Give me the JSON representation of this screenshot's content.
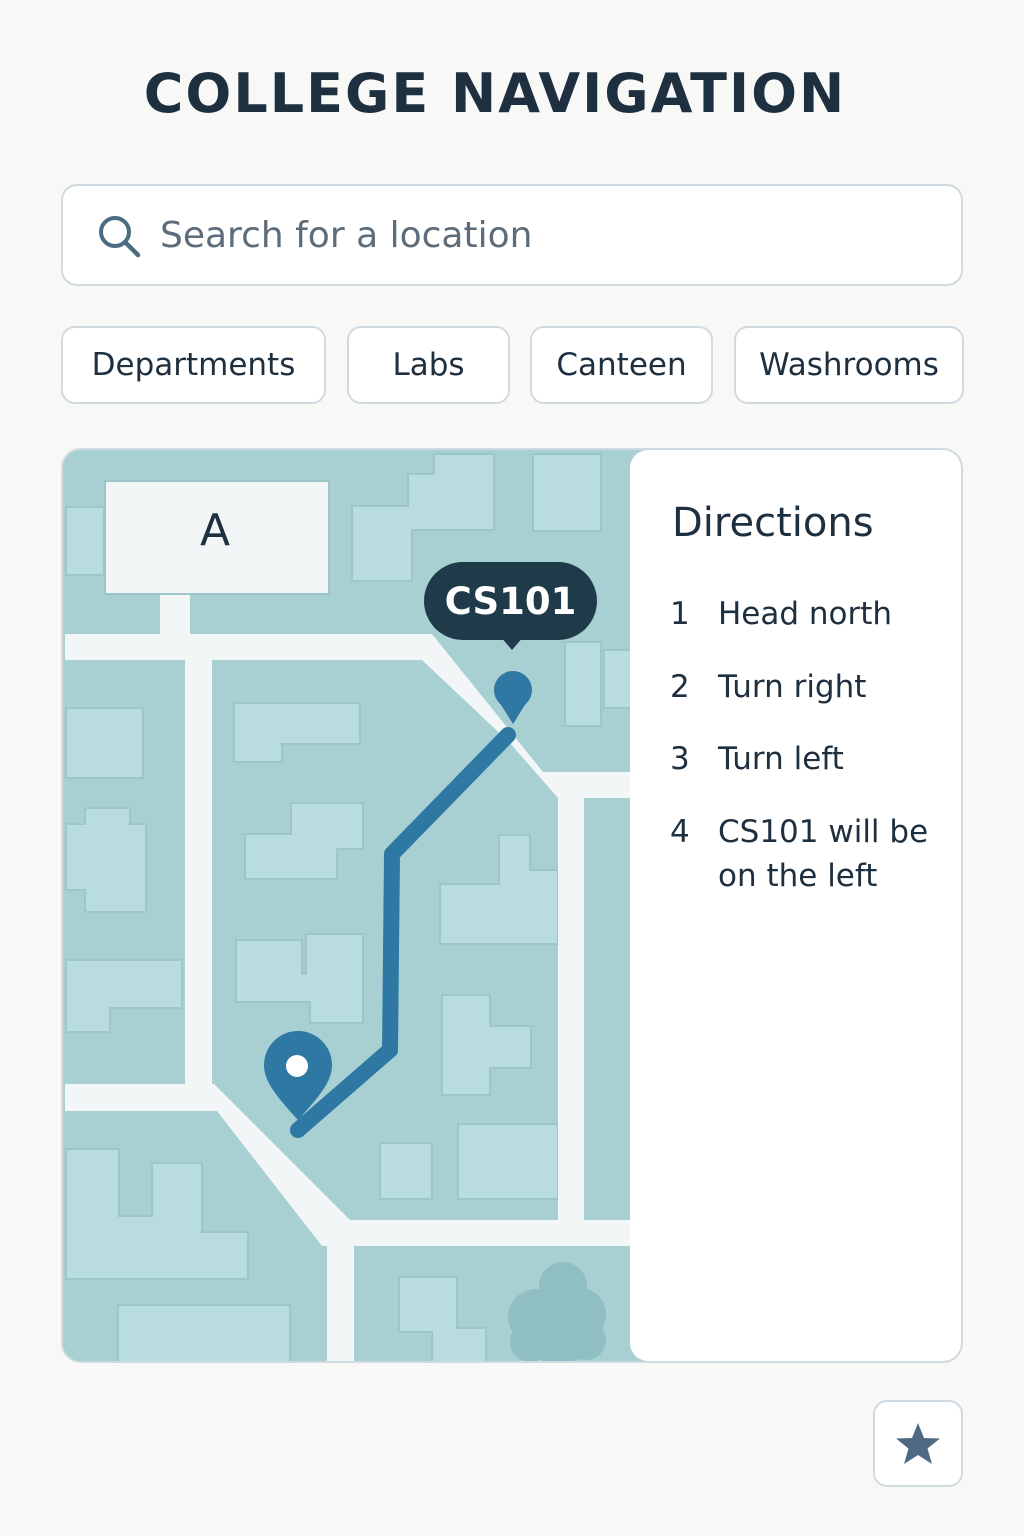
{
  "header": {
    "title": "COLLEGE NAVIGATION"
  },
  "search": {
    "placeholder": "Search for a location",
    "icon": "search-icon"
  },
  "filters": [
    {
      "label": "Departments"
    },
    {
      "label": "Labs"
    },
    {
      "label": "Canteen"
    },
    {
      "label": "Washrooms"
    }
  ],
  "map": {
    "building_label": "A",
    "destination_label": "CS101",
    "colors": {
      "base": "#a8d0d3",
      "block": "#b9dcdf",
      "road": "#f3f6f6",
      "route": "#2f78a3",
      "pin_dark": "#1f3a48"
    }
  },
  "directions": {
    "title": "Directions",
    "steps": [
      {
        "num": "1",
        "text": "Head north"
      },
      {
        "num": "2",
        "text": "Turn right"
      },
      {
        "num": "3",
        "text": "Turn left"
      },
      {
        "num": "4",
        "text": "CS101 will be on the left"
      }
    ]
  },
  "favorite": {
    "icon": "star-icon"
  }
}
